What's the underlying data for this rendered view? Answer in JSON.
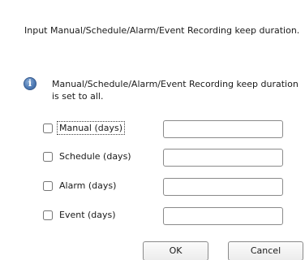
{
  "dialog": {
    "instruction": "Input Manual/Schedule/Alarm/Event Recording keep duration.",
    "info_icon": "info-icon",
    "info_text": "Manual/Schedule/Alarm/Event Recording keep duration is set to all.",
    "rows": [
      {
        "label": "Manual (days)",
        "checked": false,
        "value": ""
      },
      {
        "label": "Schedule (days)",
        "checked": false,
        "value": ""
      },
      {
        "label": "Alarm (days)",
        "checked": false,
        "value": ""
      },
      {
        "label": "Event (days)",
        "checked": false,
        "value": ""
      }
    ],
    "ok_label": "OK",
    "cancel_label": "Cancel"
  }
}
